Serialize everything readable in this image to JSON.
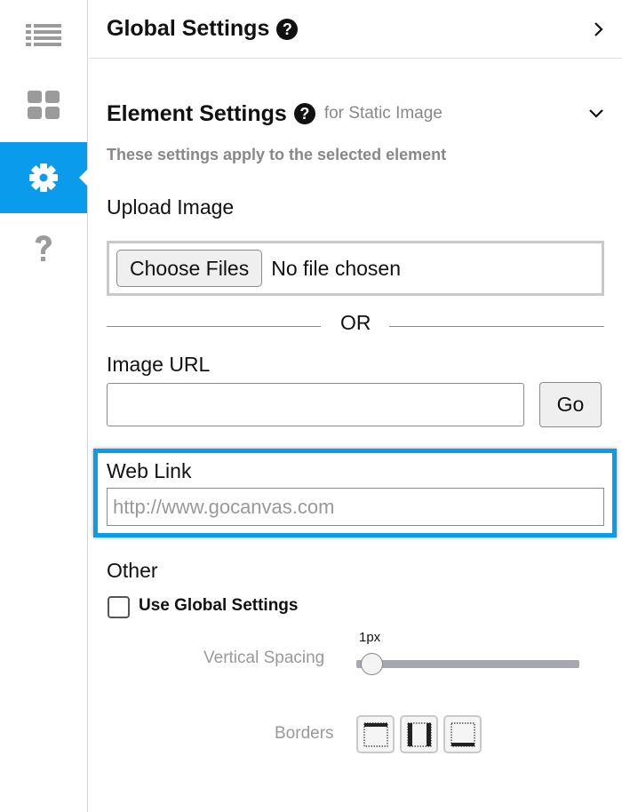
{
  "sidebar": {
    "items": [
      {
        "icon": "list-icon",
        "active": false
      },
      {
        "icon": "grid-icon",
        "active": false
      },
      {
        "icon": "gear-icon",
        "active": true
      },
      {
        "icon": "question-icon",
        "active": false
      }
    ],
    "accent": "#0a9bec"
  },
  "global_settings": {
    "title": "Global Settings",
    "help": "?"
  },
  "element_settings": {
    "title": "Element Settings",
    "help": "?",
    "for_text": "for Static Image",
    "description": "These settings apply to the selected element"
  },
  "upload": {
    "label": "Upload Image",
    "button": "Choose Files",
    "status": "No file chosen"
  },
  "or_text": "OR",
  "image_url": {
    "label": "Image URL",
    "value": "",
    "go_button": "Go"
  },
  "web_link": {
    "label": "Web Link",
    "placeholder": "http://www.gocanvas.com"
  },
  "other": {
    "label": "Other",
    "checkbox_label": "Use Global Settings",
    "checked": false,
    "vertical_spacing_label": "Vertical Spacing",
    "vertical_spacing_value": "1px",
    "borders_label": "Borders"
  }
}
